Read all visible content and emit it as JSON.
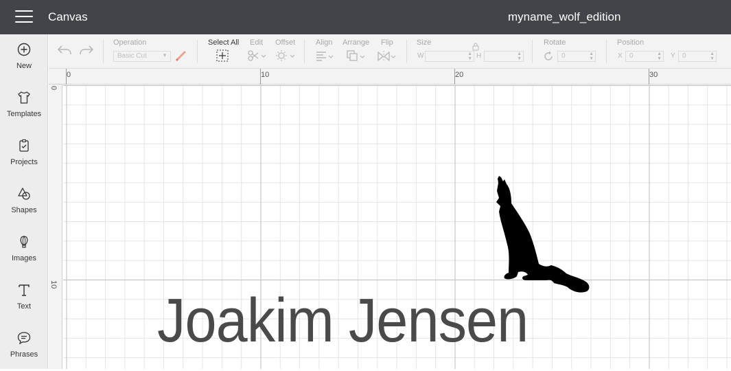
{
  "header": {
    "menu_icon": "hamburger-icon",
    "app_title": "Canvas",
    "project_name": "myname_wolf_edition"
  },
  "sidebar": {
    "items": [
      {
        "label": "New",
        "icon": "plus-circle-icon"
      },
      {
        "label": "Templates",
        "icon": "shirt-icon"
      },
      {
        "label": "Projects",
        "icon": "clipboard-icon"
      },
      {
        "label": "Shapes",
        "icon": "shapes-icon"
      },
      {
        "label": "Images",
        "icon": "balloon-icon"
      },
      {
        "label": "Text",
        "icon": "text-t-icon"
      },
      {
        "label": "Phrases",
        "icon": "speech-bubble-icon"
      }
    ]
  },
  "toolbar": {
    "operation_label": "Operation",
    "operation_value": "Basic Cut",
    "select_all_label": "Select All",
    "edit_label": "Edit",
    "offset_label": "Offset",
    "align_label": "Align",
    "arrange_label": "Arrange",
    "flip_label": "Flip",
    "size_label": "Size",
    "size_w_label": "W",
    "size_h_label": "H",
    "rotate_label": "Rotate",
    "rotate_value": "0",
    "position_label": "Position",
    "position_x_label": "X",
    "position_x_value": "0",
    "position_y_label": "Y",
    "position_y_value": "0"
  },
  "rulers": {
    "top": [
      "0",
      "10",
      "20",
      "30"
    ],
    "left": [
      "0",
      "10"
    ]
  },
  "canvas_content": {
    "text": "Joakim Jensen",
    "image": "howling-wolf-silhouette"
  },
  "colors": {
    "topbar": "#414448",
    "sidebar": "#ededed",
    "text_fill": "#4a4a4a",
    "cut_line": "#f0a090"
  }
}
